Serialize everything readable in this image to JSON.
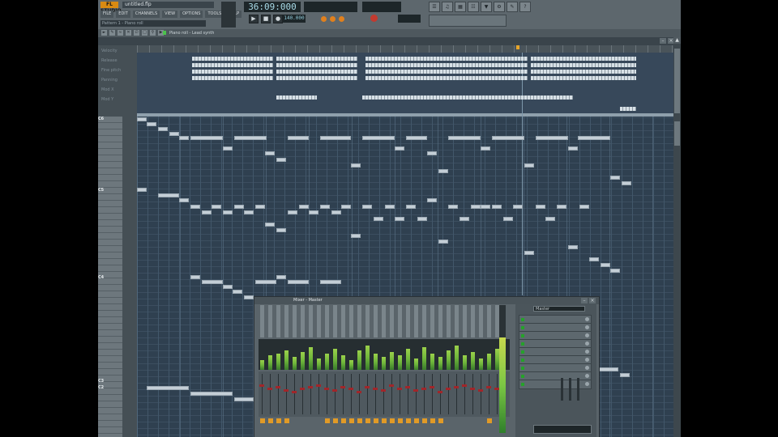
{
  "app": {
    "logo": "FL STUDIO",
    "song_title": "untitled.flp",
    "hint": "Pattern 1 - Piano roll",
    "time": "36:09:000",
    "tempo": "140.000"
  },
  "menu": [
    "FILE",
    "EDIT",
    "CHANNELS",
    "VIEW",
    "OPTIONS",
    "TOOLS",
    "HELP"
  ],
  "transport": [
    "▶",
    "■",
    "●"
  ],
  "piano_roll": {
    "title": "Piano roll - Lead synth",
    "event_labels": [
      "Velocity",
      "Release",
      "Fine pitch",
      "Panning",
      "Mod X",
      "Mod Y"
    ],
    "key_labels": [
      {
        "label": "C6",
        "row": 0
      },
      {
        "label": "C5",
        "row": 11
      },
      {
        "label": "C4",
        "row": 24
      },
      {
        "label": "C3",
        "row": 40
      },
      {
        "label": "C2",
        "row": 41
      }
    ]
  },
  "mixer": {
    "title": "Mixer - Master",
    "selector": "Master",
    "fx_slots": 9,
    "channels": 30
  },
  "colors": {
    "accent": "#d88a12",
    "grid": "#2f4050",
    "note": "#c4ced6",
    "meter": "#6fb63b"
  }
}
